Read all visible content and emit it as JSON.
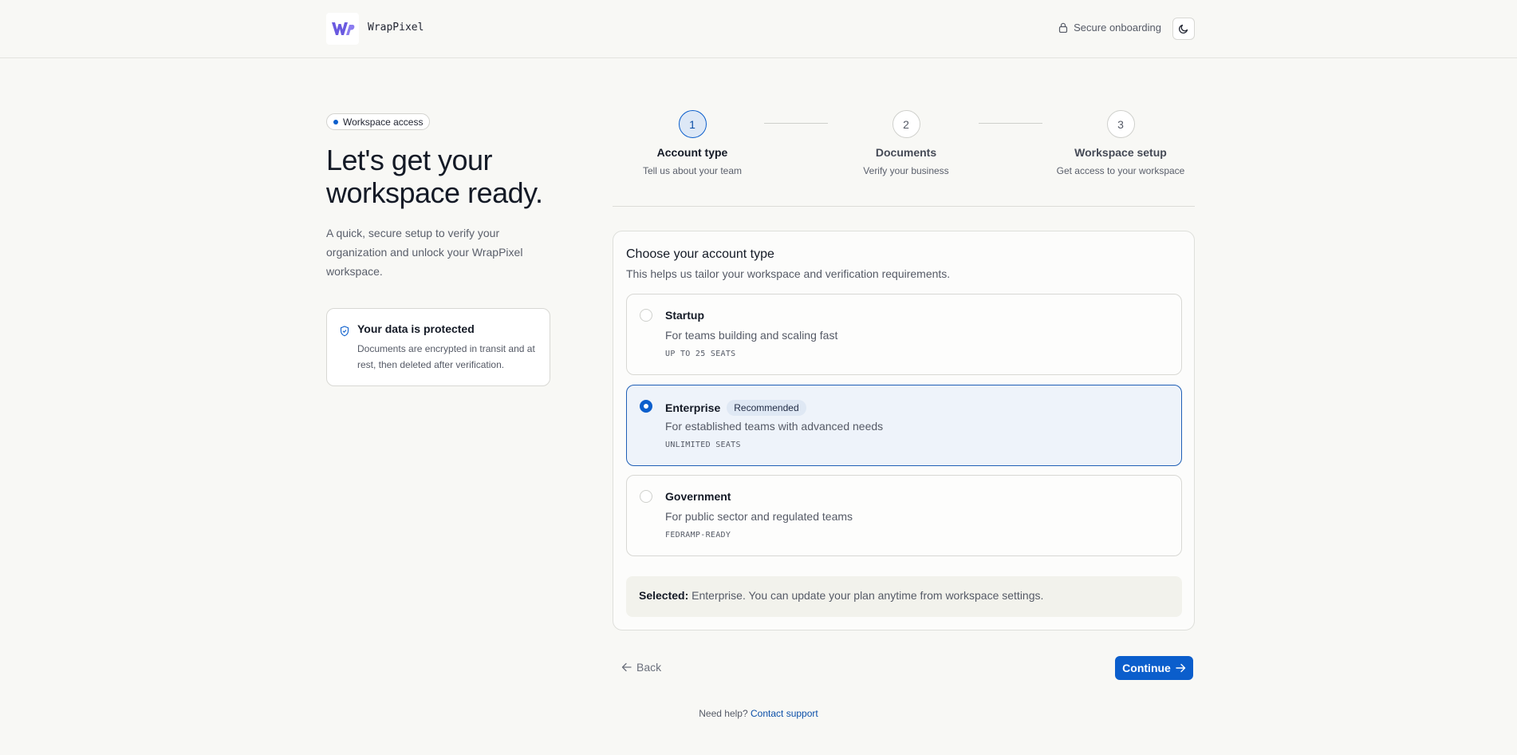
{
  "header": {
    "brand": "WrapPixel",
    "logo_icon": "wp-logo",
    "secure_label": "Secure onboarding",
    "secure_icon": "lock-icon",
    "theme_icon": "moon-icon"
  },
  "intro": {
    "pill_label": "Workspace access",
    "title": "Let's get your workspace ready.",
    "subtitle": "A quick, secure setup to verify your organization and unlock your WrapPixel workspace.",
    "protect_title": "Your data is protected",
    "protect_text": "Documents are encrypted in transit and at rest, then deleted after verification."
  },
  "steps": [
    {
      "number": "1",
      "title": "Account type",
      "desc": "Tell us about your team",
      "active": true
    },
    {
      "number": "2",
      "title": "Documents",
      "desc": "Verify your business",
      "active": false
    },
    {
      "number": "3",
      "title": "Workspace setup",
      "desc": "Get access to your workspace",
      "active": false
    }
  ],
  "account": {
    "title": "Choose your account type",
    "subtitle": "This helps us tailor your workspace and verification requirements.",
    "options": [
      {
        "name": "Startup",
        "desc": "For teams building and scaling fast",
        "meta": "UP TO 25 SEATS",
        "selected": false
      },
      {
        "name": "Enterprise",
        "badge": "Recommended",
        "desc": "For established teams with advanced needs",
        "meta": "UNLIMITED SEATS",
        "selected": true
      },
      {
        "name": "Government",
        "desc": "For public sector and regulated teams",
        "meta": "FEDRAMP-READY",
        "selected": false
      }
    ],
    "summary_label": "Selected:",
    "summary_text": "Enterprise. You can update your plan anytime from workspace settings."
  },
  "actions": {
    "back_label": "Back",
    "continue_label": "Continue"
  },
  "help": {
    "text": "Need help?",
    "link": "Contact support"
  },
  "colors": {
    "accent": "#0b5ecc",
    "logo": "#6a5ae0"
  }
}
